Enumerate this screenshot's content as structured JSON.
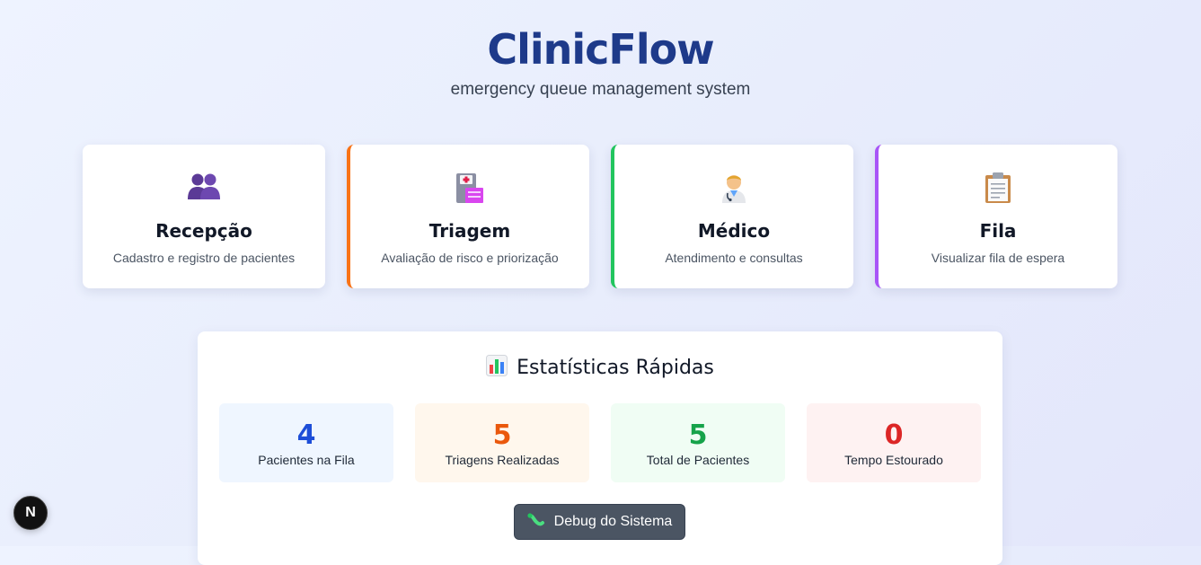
{
  "app": {
    "title": "ClinicFlow",
    "subtitle": "emergency queue management system"
  },
  "cards": [
    {
      "icon": "people-icon",
      "title": "Recepção",
      "description": "Cadastro e registro de pacientes"
    },
    {
      "icon": "hospital-icon",
      "title": "Triagem",
      "description": "Avaliação de risco e priorização",
      "accent": "#f97316"
    },
    {
      "icon": "doctor-icon",
      "title": "Médico",
      "description": "Atendimento e consultas",
      "accent": "#22c55e"
    },
    {
      "icon": "clipboard-icon",
      "title": "Fila",
      "description": "Visualizar fila de espera",
      "accent": "#a855f7"
    }
  ],
  "stats": {
    "title": "Estatísticas Rápidas",
    "icon": "bar-chart-icon",
    "items": [
      {
        "value": "4",
        "label": "Pacientes na Fila",
        "color": "#1d4ed8",
        "bg": "#eff6ff"
      },
      {
        "value": "5",
        "label": "Triagens Realizadas",
        "color": "#ea580c",
        "bg": "#fff7ed"
      },
      {
        "value": "5",
        "label": "Total de Pacientes",
        "color": "#16a34a",
        "bg": "#f0fdf4"
      },
      {
        "value": "0",
        "label": "Tempo Estourado",
        "color": "#dc2626",
        "bg": "#fef2f2"
      }
    ],
    "debug_button": {
      "label": "Debug do Sistema",
      "icon": "worm-icon"
    }
  },
  "dev_badge": {
    "label": "N",
    "icon": "nextjs-icon"
  }
}
